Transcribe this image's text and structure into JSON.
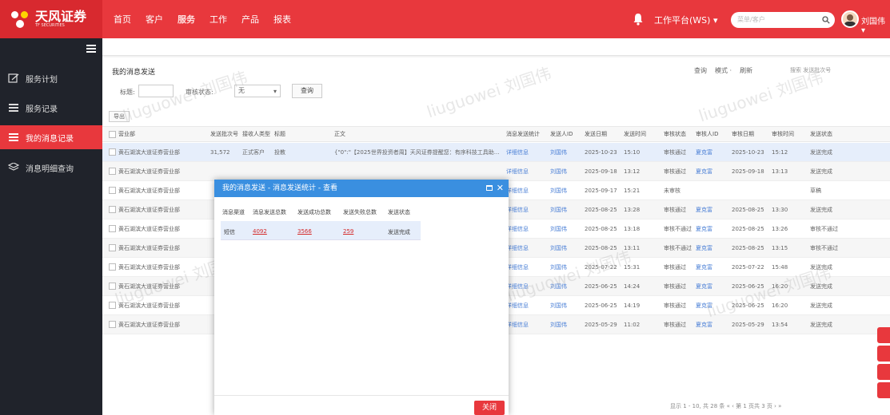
{
  "header": {
    "brand": "天风证券",
    "brand_sub": "TF SECURITIES",
    "nav": [
      "首页",
      "客户",
      "服务",
      "工作",
      "产品",
      "报表"
    ],
    "active_nav": "服务",
    "workbench": "工作平台(WS) ▾",
    "search_placeholder": "菜单/客户",
    "username": "刘国伟 ▾"
  },
  "sidebar": {
    "items": [
      "服务计划",
      "服务记录",
      "我的消息记录",
      "消息明细查询"
    ],
    "active": "我的消息记录"
  },
  "panel": {
    "title": "我的消息发送",
    "tools": [
      "查询",
      "模式 ·",
      "刷新"
    ],
    "search_hint": "搜索 发送批次号",
    "filter_title_label": "标题:",
    "filter_status_label": "审核状态:",
    "filter_status_value": "无",
    "query_button": "查询",
    "export_button": "导出"
  },
  "table": {
    "headers": [
      "营业部",
      "发送批次号",
      "接收人类型",
      "标题",
      "正文",
      "消息发送统计",
      "发送人ID",
      "发送日期",
      "发送时间",
      "审核状态",
      "审核人ID",
      "审核日期",
      "审核时间",
      "发送状态"
    ],
    "rows": [
      {
        "dept": "黄石湖滨大道证券营业部",
        "batch": "31,572",
        "recv": "正式客户",
        "title": "投教",
        "body": "{\"0\":\"【2025世界投资者周】天风证券提醒您：有序科技工具助...",
        "stat": "详细信息",
        "sender": "刘国伟",
        "date": "2025-10-23",
        "time": "15:10",
        "audit": "审核通过",
        "auditor": "夏克富",
        "adate": "2025-10-23",
        "atime": "15:12",
        "status": "发送完成"
      },
      {
        "dept": "黄石湖滨大道证券营业部",
        "batch": "",
        "recv": "",
        "title": "",
        "body": "",
        "stat": "详细信息",
        "sender": "刘国伟",
        "date": "2025-09-18",
        "time": "13:12",
        "audit": "审核通过",
        "auditor": "夏克富",
        "adate": "2025-09-18",
        "atime": "13:13",
        "status": "发送完成"
      },
      {
        "dept": "黄石湖滨大道证券营业部",
        "batch": "",
        "recv": "",
        "title": "",
        "body": "",
        "stat": "详细信息",
        "sender": "刘国伟",
        "date": "2025-09-17",
        "time": "15:21",
        "audit": "未审核",
        "auditor": "",
        "adate": "",
        "atime": "",
        "status": "草稿"
      },
      {
        "dept": "黄石湖滨大道证券营业部",
        "batch": "",
        "recv": "",
        "title": "",
        "body": "",
        "stat": "详细信息",
        "sender": "刘国伟",
        "date": "2025-08-25",
        "time": "13:28",
        "audit": "审核通过",
        "auditor": "夏克富",
        "adate": "2025-08-25",
        "atime": "13:30",
        "status": "发送完成"
      },
      {
        "dept": "黄石湖滨大道证券营业部",
        "batch": "",
        "recv": "",
        "title": "",
        "body": "",
        "stat": "详细信息",
        "sender": "刘国伟",
        "date": "2025-08-25",
        "time": "13:18",
        "audit": "审核不通过",
        "auditor": "夏克富",
        "adate": "2025-08-25",
        "atime": "13:26",
        "status": "审核不通过"
      },
      {
        "dept": "黄石湖滨大道证券营业部",
        "batch": "",
        "recv": "",
        "title": "",
        "body": "",
        "stat": "详细信息",
        "sender": "刘国伟",
        "date": "2025-08-25",
        "time": "13:11",
        "audit": "审核不通过",
        "auditor": "夏克富",
        "adate": "2025-08-25",
        "atime": "13:15",
        "status": "审核不通过"
      },
      {
        "dept": "黄石湖滨大道证券营业部",
        "batch": "",
        "recv": "",
        "title": "",
        "body": "",
        "stat": "详细信息",
        "sender": "刘国伟",
        "date": "2025-07-22",
        "time": "15:31",
        "audit": "审核通过",
        "auditor": "夏克富",
        "adate": "2025-07-22",
        "atime": "15:48",
        "status": "发送完成"
      },
      {
        "dept": "黄石湖滨大道证券营业部",
        "batch": "",
        "recv": "",
        "title": "",
        "body": "",
        "stat": "详细信息",
        "sender": "刘国伟",
        "date": "2025-06-25",
        "time": "14:24",
        "audit": "审核通过",
        "auditor": "夏克富",
        "adate": "2025-06-25",
        "atime": "16:20",
        "status": "发送完成"
      },
      {
        "dept": "黄石湖滨大道证券营业部",
        "batch": "",
        "recv": "",
        "title": "",
        "body": "",
        "stat": "详细信息",
        "sender": "刘国伟",
        "date": "2025-06-25",
        "time": "14:19",
        "audit": "审核通过",
        "auditor": "夏克富",
        "adate": "2025-06-25",
        "atime": "16:20",
        "status": "发送完成"
      },
      {
        "dept": "黄石湖滨大道证券营业部",
        "batch": "",
        "recv": "",
        "title": "",
        "body": "",
        "stat": "详细信息",
        "sender": "刘国伟",
        "date": "2025-05-29",
        "time": "11:02",
        "audit": "审核通过",
        "auditor": "夏克富",
        "adate": "2025-05-29",
        "atime": "13:54",
        "status": "发送完成"
      }
    ]
  },
  "pager": "显示 1 - 10, 共 28 条  «  ‹  第  1 页共 3 页  ›  »",
  "modal": {
    "title": "我的消息发送 - 消息发送统计 - 查看",
    "headers": [
      "消息渠道",
      "消息发送总数",
      "发送成功总数",
      "发送失败总数",
      "发送状态"
    ],
    "row": {
      "channel": "短信",
      "total": "4092",
      "success": "3566",
      "fail": "259",
      "status": "发送完成"
    },
    "close_button": "关闭"
  },
  "watermark": "liuguowei 刘国伟",
  "colors": {
    "brand_red": "#e8383d",
    "sidebar": "#20232b",
    "modal_blue": "#3a8fe0"
  }
}
